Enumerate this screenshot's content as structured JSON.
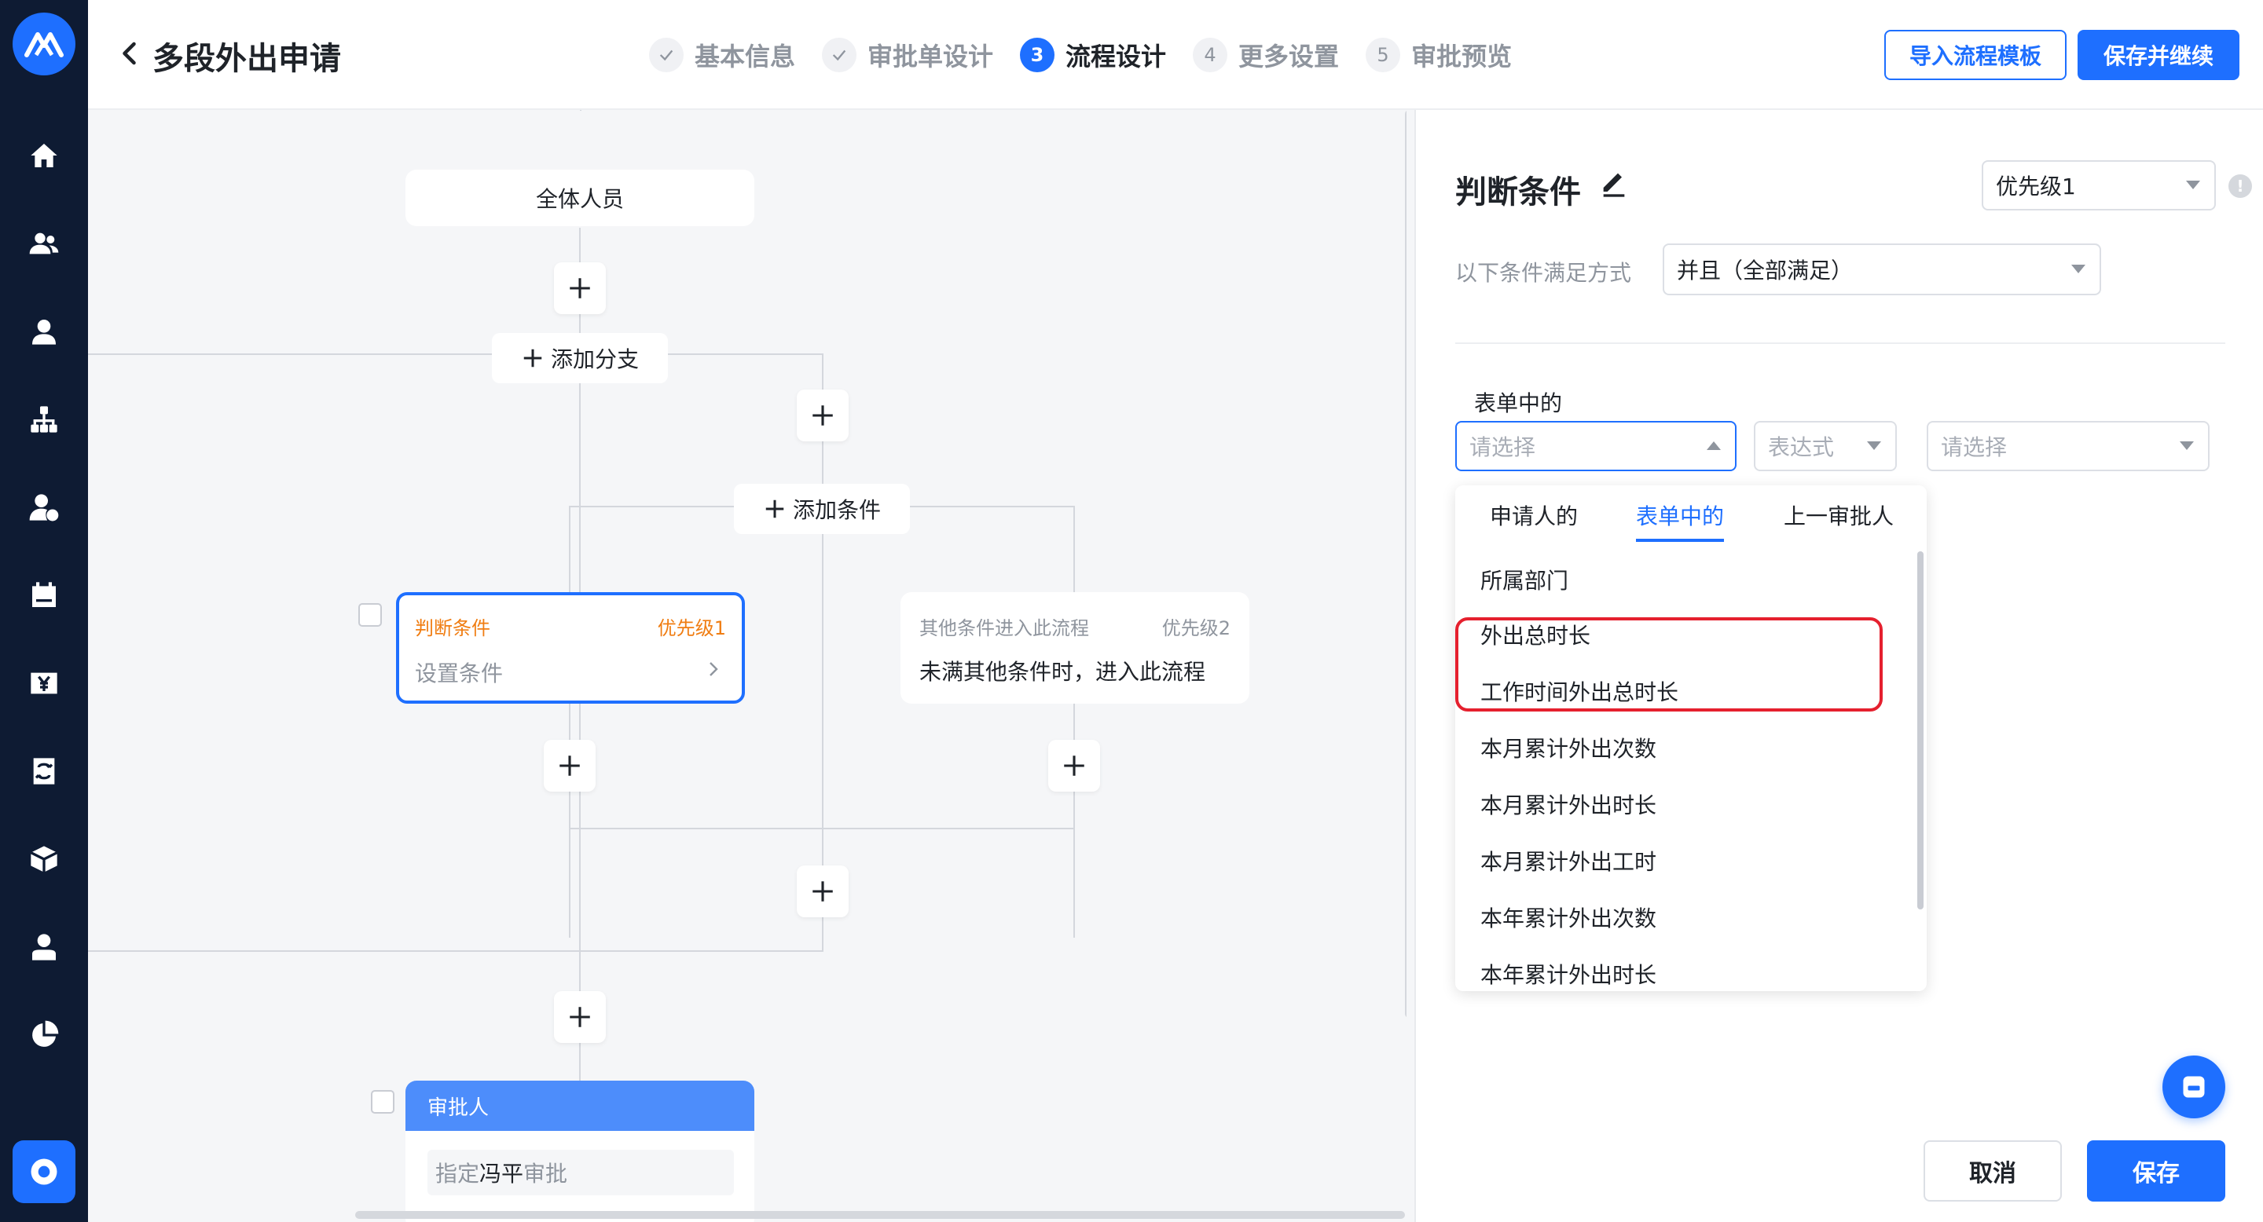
{
  "header": {
    "title": "多段外出申请",
    "steps": [
      {
        "number": "1",
        "label": "基本信息",
        "state": "done"
      },
      {
        "number": "2",
        "label": "审批单设计",
        "state": "done"
      },
      {
        "number": "3",
        "label": "流程设计",
        "state": "active"
      },
      {
        "number": "4",
        "label": "更多设置",
        "state": "todo"
      },
      {
        "number": "5",
        "label": "审批预览",
        "state": "todo"
      }
    ],
    "import_button": "导入流程模板",
    "save_continue_button": "保存并继续"
  },
  "flow": {
    "start_node": "全体人员",
    "add_branch": "添加分支",
    "add_condition": "添加条件",
    "condition_node": {
      "title": "判断条件",
      "priority": "优先级1",
      "body": "设置条件"
    },
    "else_node": {
      "title": "其他条件进入此流程",
      "priority": "优先级2",
      "body": "未满其他条件时，进入此流程"
    },
    "approver_node": {
      "title": "审批人",
      "body_prefix": "指定",
      "body_name": "冯平",
      "body_suffix": "审批"
    }
  },
  "panel": {
    "title": "判断条件",
    "priority_select": "优先级1",
    "match_label": "以下条件满足方式",
    "match_select": "并且（全部满足）",
    "source_label": "表单中的",
    "field_placeholder": "请选择",
    "expression_placeholder": "表达式",
    "value_placeholder": "请选择",
    "dropdown": {
      "tabs": [
        "申请人的",
        "表单中的",
        "上一审批人"
      ],
      "active_tab": 1,
      "items": [
        "所属部门",
        "外出总时长",
        "工作时间外出总时长",
        "本月累计外出次数",
        "本月累计外出时长",
        "本月累计外出工时",
        "本年累计外出次数",
        "本年累计外出时长"
      ]
    },
    "cancel_button": "取消",
    "save_button": "保存"
  },
  "colors": {
    "accent": "#1e6fff",
    "sidebar": "#0e1b33",
    "highlight": "#e5202e",
    "condition_title": "#f07d12"
  }
}
